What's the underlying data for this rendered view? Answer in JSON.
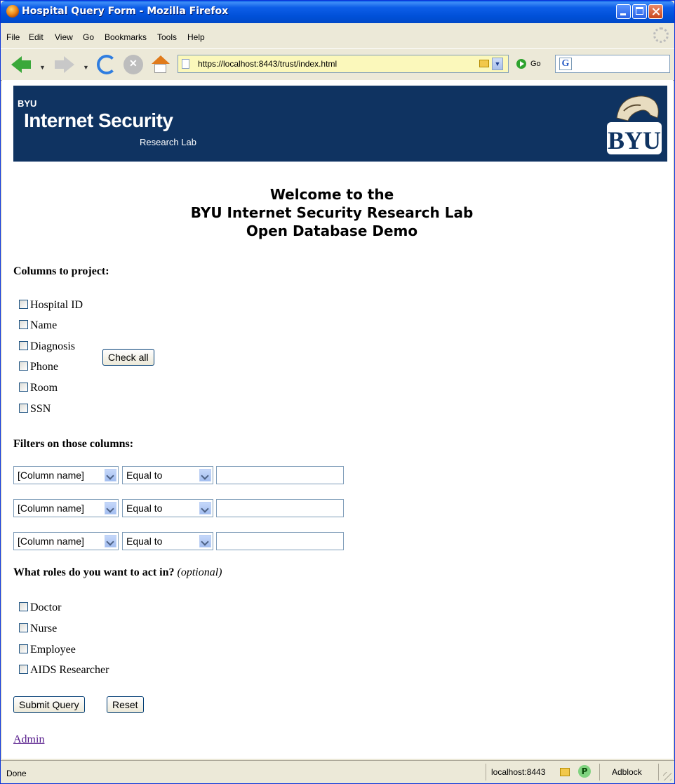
{
  "window": {
    "title": "Hospital Query Form - Mozilla Firefox"
  },
  "menu": [
    "File",
    "Edit",
    "View",
    "Go",
    "Bookmarks",
    "Tools",
    "Help"
  ],
  "toolbar": {
    "url": "https://localhost:8443/trust/index.html",
    "go_label": "Go"
  },
  "banner": {
    "small": "BYU",
    "title": "Internet Security",
    "subtitle": "Research Lab",
    "logo_text": "BYU"
  },
  "heading": [
    "Welcome to the",
    "BYU Internet Security Research Lab",
    "Open Database Demo"
  ],
  "projection": {
    "label": "Columns to project:",
    "columns": [
      "Hospital ID",
      "Name",
      "Diagnosis",
      "Phone",
      "Room",
      "SSN"
    ],
    "check_all": "Check all"
  },
  "filters": {
    "label": "Filters on those columns:",
    "rows": [
      {
        "column": "[Column name]",
        "op": "Equal to",
        "value": ""
      },
      {
        "column": "[Column name]",
        "op": "Equal to",
        "value": ""
      },
      {
        "column": "[Column name]",
        "op": "Equal to",
        "value": ""
      }
    ]
  },
  "roles": {
    "label": "What roles do you want to act in?",
    "optional": "(optional)",
    "items": [
      "Doctor",
      "Nurse",
      "Employee",
      "AIDS Researcher"
    ]
  },
  "form": {
    "submit": "Submit Query",
    "reset": "Reset"
  },
  "admin_link": "Admin",
  "status": {
    "text": "Done",
    "host": "localhost:8443",
    "adblock": "Adblock",
    "p": "P"
  },
  "colors": {
    "banner": "#0f3361",
    "titlebar": "#0050d8",
    "link": "#551a8b"
  }
}
